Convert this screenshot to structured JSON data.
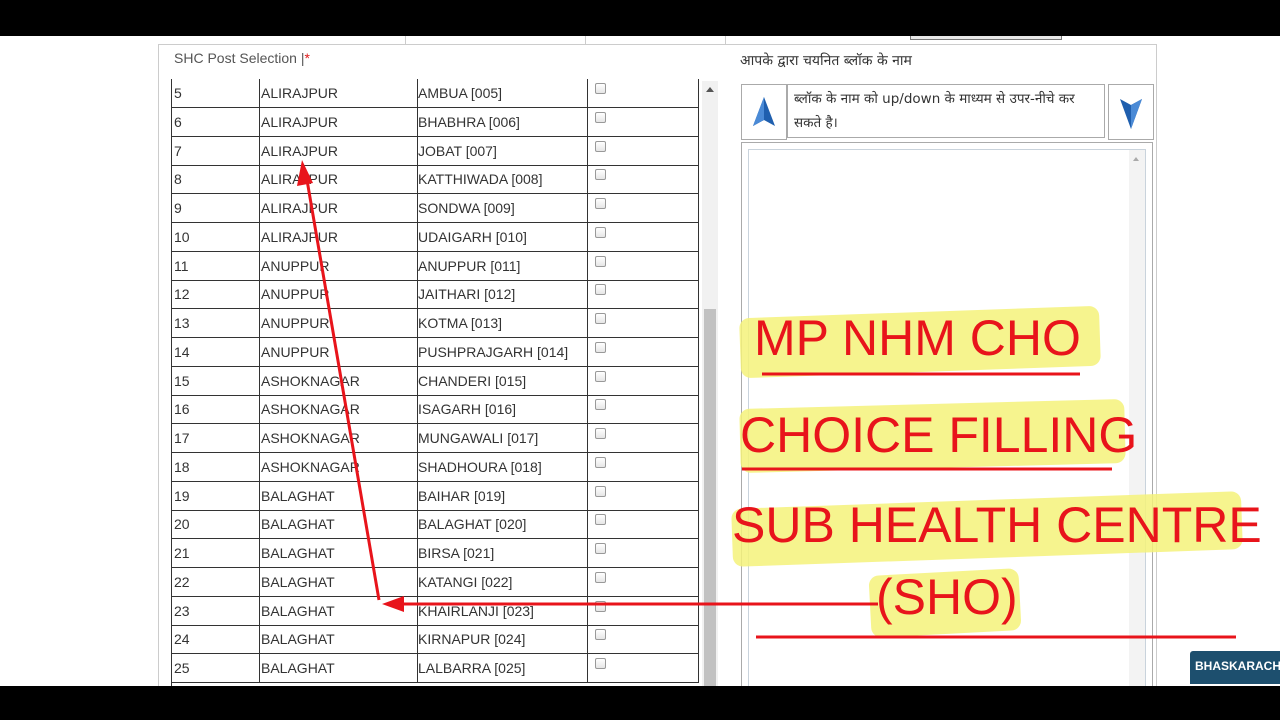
{
  "left_panel": {
    "title": "SHC Post Selection |",
    "required_mark": "*",
    "rows": [
      {
        "num": "5",
        "district": "ALIRAJPUR",
        "block": "AMBUA [005]"
      },
      {
        "num": "6",
        "district": "ALIRAJPUR",
        "block": "BHABHRA [006]"
      },
      {
        "num": "7",
        "district": "ALIRAJPUR",
        "block": "JOBAT [007]"
      },
      {
        "num": "8",
        "district": "ALIRAJPUR",
        "block": "KATTHIWADA [008]"
      },
      {
        "num": "9",
        "district": "ALIRAJPUR",
        "block": "SONDWA [009]"
      },
      {
        "num": "10",
        "district": "ALIRAJPUR",
        "block": "UDAIGARH [010]"
      },
      {
        "num": "11",
        "district": "ANUPPUR",
        "block": "ANUPPUR [011]"
      },
      {
        "num": "12",
        "district": "ANUPPUR",
        "block": "JAITHARI [012]"
      },
      {
        "num": "13",
        "district": "ANUPPUR",
        "block": "KOTMA [013]"
      },
      {
        "num": "14",
        "district": "ANUPPUR",
        "block": "PUSHPRAJGARH [014]"
      },
      {
        "num": "15",
        "district": "ASHOKNAGAR",
        "block": "CHANDERI [015]"
      },
      {
        "num": "16",
        "district": "ASHOKNAGAR",
        "block": "ISAGARH [016]"
      },
      {
        "num": "17",
        "district": "ASHOKNAGAR",
        "block": "MUNGAWALI [017]"
      },
      {
        "num": "18",
        "district": "ASHOKNAGAR",
        "block": "SHADHOURA [018]"
      },
      {
        "num": "19",
        "district": "BALAGHAT",
        "block": "BAIHAR [019]"
      },
      {
        "num": "20",
        "district": "BALAGHAT",
        "block": "BALAGHAT [020]"
      },
      {
        "num": "21",
        "district": "BALAGHAT",
        "block": "BIRSA [021]"
      },
      {
        "num": "22",
        "district": "BALAGHAT",
        "block": "KATANGI [022]"
      },
      {
        "num": "23",
        "district": "BALAGHAT",
        "block": "KHAIRLANJI [023]"
      },
      {
        "num": "24",
        "district": "BALAGHAT",
        "block": "KIRNAPUR [024]"
      },
      {
        "num": "25",
        "district": "BALAGHAT",
        "block": "LALBARRA [025]"
      }
    ]
  },
  "right_panel": {
    "title": "आपके द्वारा चयनित ब्लॉक के नाम",
    "note": "ब्लॉक के नाम को up/down के माध्यम से उपर-नीचे कर सकते है।",
    "up_icon": "arrow-up-icon",
    "down_icon": "arrow-down-icon"
  },
  "overlay": {
    "line1": "MP NHM CHO",
    "line2": "CHOICE FILLING",
    "line3": "SUB HEALTH CENTRE",
    "line4": "(SHO)",
    "color": "#e8141b",
    "highlight_color": "#f5f27a"
  },
  "badge": {
    "text": "BHASKARACH"
  },
  "colors": {
    "accent_blue": "#1f5fae",
    "badge_bg": "#1d4f6e"
  }
}
